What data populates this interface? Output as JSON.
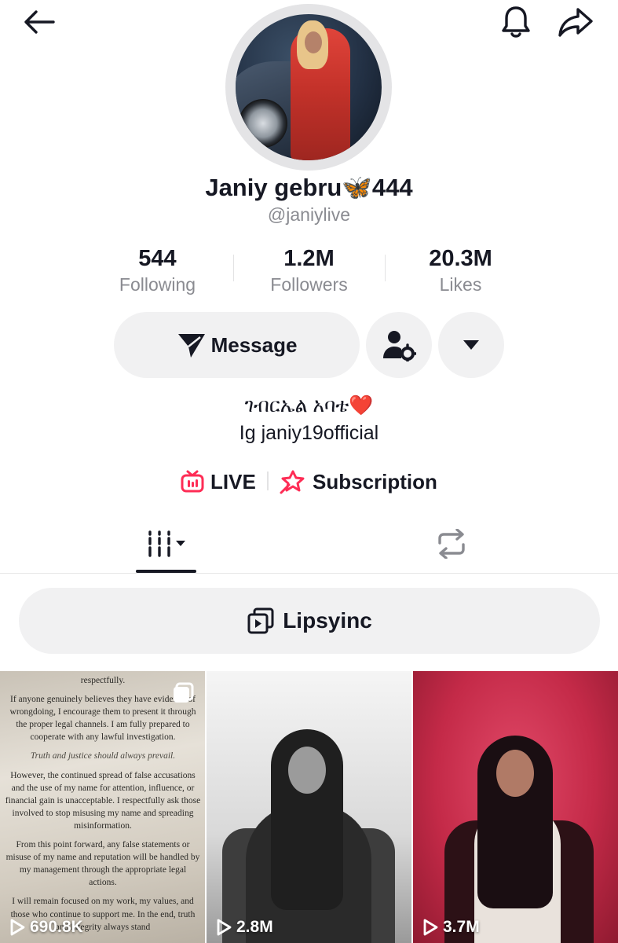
{
  "profile": {
    "name": "Janiy gebru🦋444",
    "handle": "@janiylive",
    "bio_line1": "ገብርኤል አባቴ❤️",
    "bio_line2": "Ig janiy19official"
  },
  "stats": {
    "following": {
      "value": "544",
      "label": "Following"
    },
    "followers": {
      "value": "1.2M",
      "label": "Followers"
    },
    "likes": {
      "value": "20.3M",
      "label": "Likes"
    }
  },
  "actions": {
    "message_label": "Message"
  },
  "links": {
    "live_label": "LIVE",
    "subscription_label": "Subscription"
  },
  "playlist": {
    "label": "Lipsyinc"
  },
  "videos": [
    {
      "views": "690.8K"
    },
    {
      "views": "2.8M"
    },
    {
      "views": "3.7M"
    }
  ],
  "notice_text": {
    "p1": "respectfully.",
    "p2": "If anyone genuinely believes they have evidence of wrongdoing, I encourage them to present it through the proper legal channels. I am fully prepared to cooperate with any lawful investigation.",
    "p3": "Truth and justice should always prevail.",
    "p4": "However, the continued spread of false accusations and the use of my name for attention, influence, or financial gain is unacceptable. I respectfully ask those involved to stop misusing my name and spreading misinformation.",
    "p5": "From this point forward, any false statements or misuse of my name and reputation will be handled by my management through the appropriate legal actions.",
    "p6": "I will remain focused on my work, my values, and those who continue to support me. In the end, truth and integrity always stand"
  },
  "colors": {
    "accent_pink": "#fe2c55",
    "text_primary": "#161823",
    "text_secondary": "#8a8b91",
    "button_bg": "#f1f1f2"
  },
  "icons": {
    "back": "arrow-left-icon",
    "bell": "bell-icon",
    "share": "share-arrow-icon",
    "message": "paper-plane-icon",
    "follow_settings": "person-gear-icon",
    "more": "caret-down-icon",
    "live": "live-tv-icon",
    "subscription": "star-badge-icon",
    "videos_tab": "grid-bars-icon",
    "repost_tab": "repost-icon",
    "playlist": "playlist-icon",
    "play": "play-icon",
    "multi": "multi-photo-icon"
  }
}
